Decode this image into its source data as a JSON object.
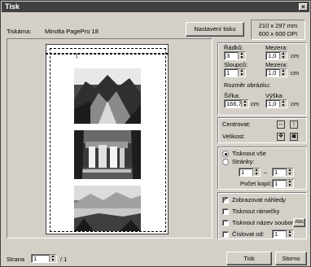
{
  "window": {
    "title": "Tisk",
    "close_glyph": "×"
  },
  "printer": {
    "label": "Tiskárna:",
    "name": "Minolta PagePro 18",
    "settings_button": "Nastavení tisku",
    "paper_size": "210 x 297 mm",
    "resolution": "600 x 600 DPI"
  },
  "layout": {
    "rows_label": "Řádků:",
    "rows_value": "3",
    "cols_label": "Sloupců:",
    "cols_value": "1",
    "gap_row_label": "Mezera:",
    "gap_row_value": "1,0",
    "gap_col_label": "Mezera:",
    "gap_col_value": "1,0",
    "unit": "cm",
    "image_size_label": "Rozměr obrázku:",
    "width_label": "Šířka:",
    "width_value": "166,7",
    "height_label": "Výška:",
    "height_value": "1,0"
  },
  "position": {
    "center_label": "Centrovat:",
    "size_label": "Velikost:"
  },
  "range": {
    "print_all": "Tisknout vše",
    "pages_label": "Stránky:",
    "page_from": "1",
    "page_to": "1",
    "dash": "–",
    "copies_label": "Počet kopií:",
    "copies_value": "1",
    "selected": "print_all"
  },
  "options": {
    "show_previews": "Zobrazovat náhledy",
    "print_frames": "Tisknout rámečky",
    "print_filename": "Tisknout název souboru",
    "font_button": "Abc",
    "numbering": "Číslovat od:",
    "numbering_value": "1",
    "checked": {
      "show_previews": true,
      "print_frames": false,
      "print_filename": false,
      "numbering": false
    }
  },
  "footer": {
    "page_label": "Strana",
    "page_value": "1",
    "page_total": "/ 1",
    "print_button": "Tisk",
    "cancel_button": "Storno"
  }
}
